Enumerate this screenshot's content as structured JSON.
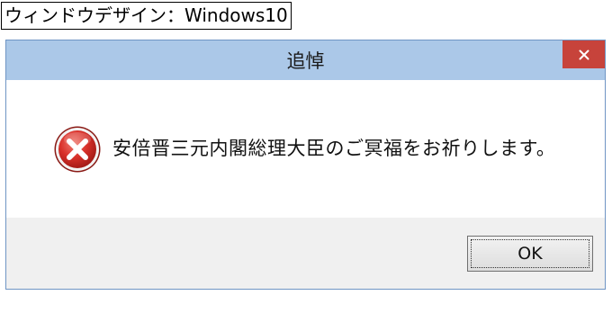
{
  "caption": "ウィンドウデザイン：Windows10",
  "window": {
    "title": "追悼",
    "close_glyph": "✕",
    "message": "安倍晋三元内閣総理大臣のご冥福をお祈りします。",
    "icon": "error-icon",
    "ok_label": "OK"
  },
  "colors": {
    "titlebar": "#abc8e8",
    "close": "#c7433b",
    "footer": "#f0f0f0",
    "error": "#d9312a"
  }
}
